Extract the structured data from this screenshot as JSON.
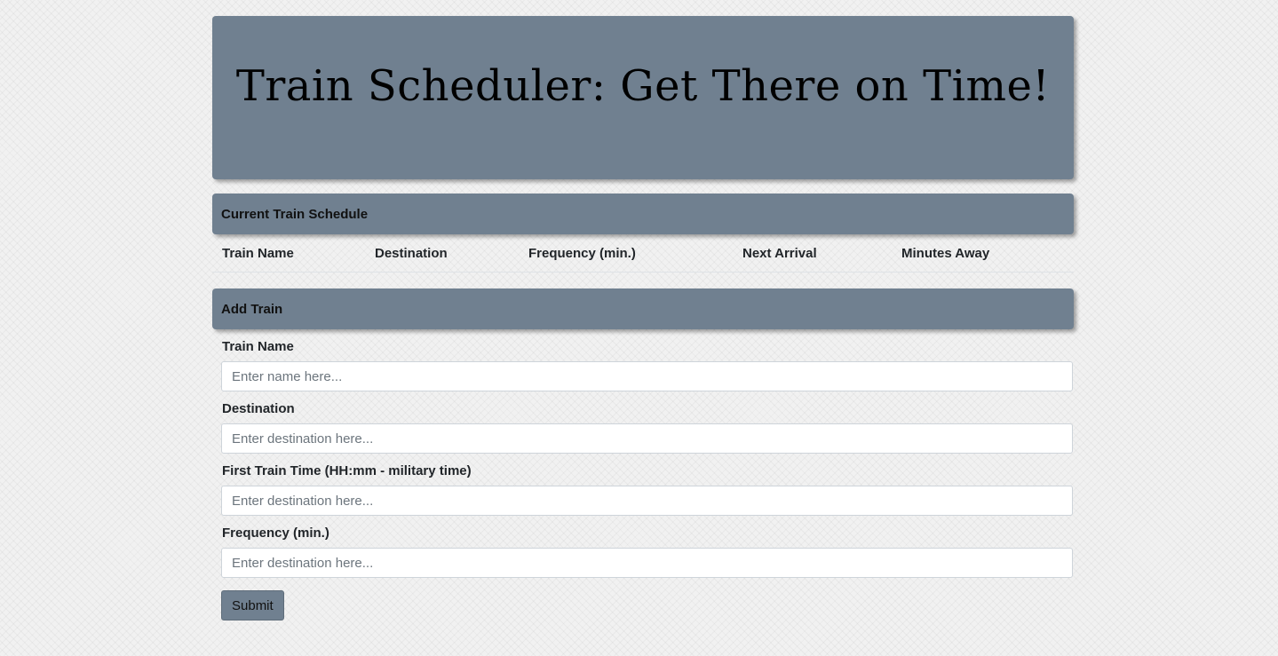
{
  "header": {
    "title": "Train Scheduler: Get There on Time!"
  },
  "schedule": {
    "title": "Current Train Schedule",
    "columns": [
      "Train Name",
      "Destination",
      "Frequency (min.)",
      "Next Arrival",
      "Minutes Away"
    ]
  },
  "add_train": {
    "title": "Add Train",
    "fields": [
      {
        "label": "Train Name",
        "placeholder": "Enter name here...",
        "value": ""
      },
      {
        "label": "Destination",
        "placeholder": "Enter destination here...",
        "value": ""
      },
      {
        "label": "First Train Time (HH:mm - military time)",
        "placeholder": "Enter destination here...",
        "value": ""
      },
      {
        "label": "Frequency (min.)",
        "placeholder": "Enter destination here...",
        "value": ""
      }
    ],
    "submit_label": "Submit"
  },
  "colors": {
    "panel": "#708090",
    "background": "#f1f1f1"
  }
}
